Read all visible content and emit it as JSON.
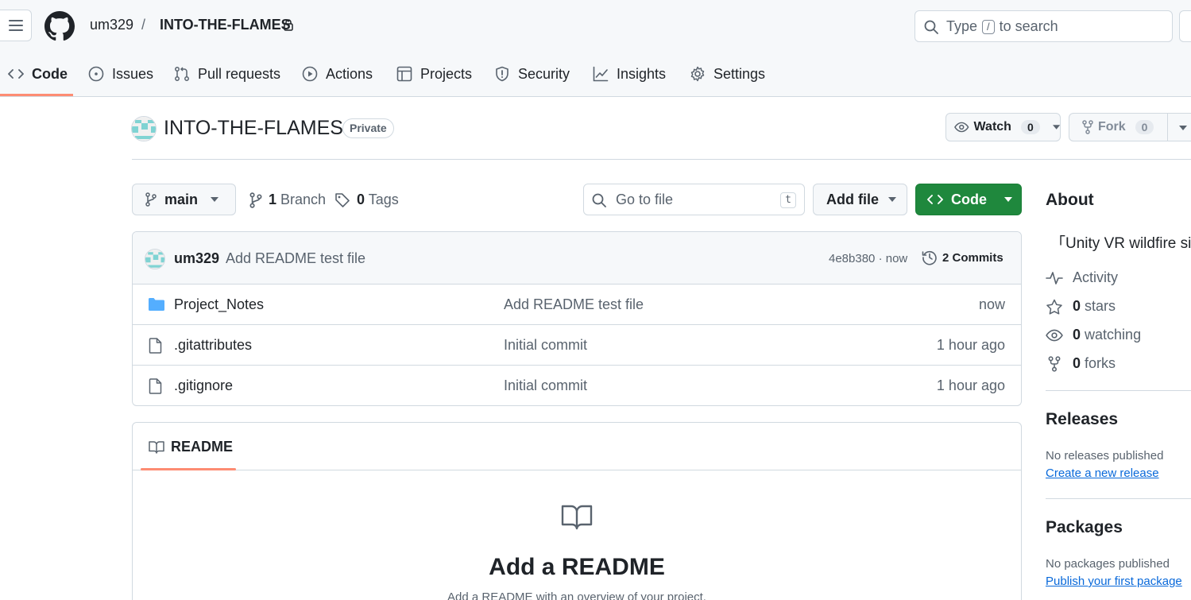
{
  "header": {
    "owner": "um329",
    "separator": "/",
    "repo": "INTO-THE-FLAMES",
    "search_prefix": "Type",
    "search_key": "/",
    "search_suffix": "to search"
  },
  "tabs": [
    {
      "label": "Code",
      "icon": "code-icon",
      "active": true
    },
    {
      "label": "Issues",
      "icon": "issue-icon"
    },
    {
      "label": "Pull requests",
      "icon": "pull-request-icon"
    },
    {
      "label": "Actions",
      "icon": "play-icon"
    },
    {
      "label": "Projects",
      "icon": "table-icon"
    },
    {
      "label": "Security",
      "icon": "shield-icon"
    },
    {
      "label": "Insights",
      "icon": "graph-icon"
    },
    {
      "label": "Settings",
      "icon": "gear-icon"
    }
  ],
  "repo_header": {
    "title": "INTO-THE-FLAMES",
    "visibility": "Private",
    "watch_label": "Watch",
    "watch_count": "0",
    "fork_label": "Fork",
    "fork_count": "0"
  },
  "controls": {
    "branch": "main",
    "branch_count": "1",
    "branch_label": "Branch",
    "tag_count": "0",
    "tag_label": "Tags",
    "goto_placeholder": "Go to file",
    "goto_key": "t",
    "add_file": "Add file",
    "code": "Code"
  },
  "latest_commit": {
    "author": "um329",
    "message": "Add README test file",
    "sha_time": "4e8b380 · now",
    "commits": "2 Commits"
  },
  "files": [
    {
      "name": "Project_Notes",
      "type": "folder",
      "commit": "Add README test file",
      "time": "now"
    },
    {
      "name": ".gitattributes",
      "type": "file",
      "commit": "Initial commit",
      "time": "1 hour ago"
    },
    {
      "name": ".gitignore",
      "type": "file",
      "commit": "Initial commit",
      "time": "1 hour ago"
    }
  ],
  "readme": {
    "tab": "README",
    "title": "Add a README",
    "subtitle": "Add a README with an overview of your project."
  },
  "sidebar": {
    "about_heading": "About",
    "description": "「Unity VR wildfire si",
    "activity": "Activity",
    "stars_count": "0",
    "stars_label": "stars",
    "watching_count": "0",
    "watching_label": "watching",
    "forks_count": "0",
    "forks_label": "forks",
    "releases_heading": "Releases",
    "releases_text": "No releases published",
    "releases_link": "Create a new release",
    "packages_heading": "Packages",
    "packages_text": "No packages published",
    "packages_link": "Publish your first package"
  },
  "colors": {
    "accent": "#fd8c73",
    "primary_button": "#1f883d",
    "link": "#0969da",
    "folder": "#54aeff"
  }
}
